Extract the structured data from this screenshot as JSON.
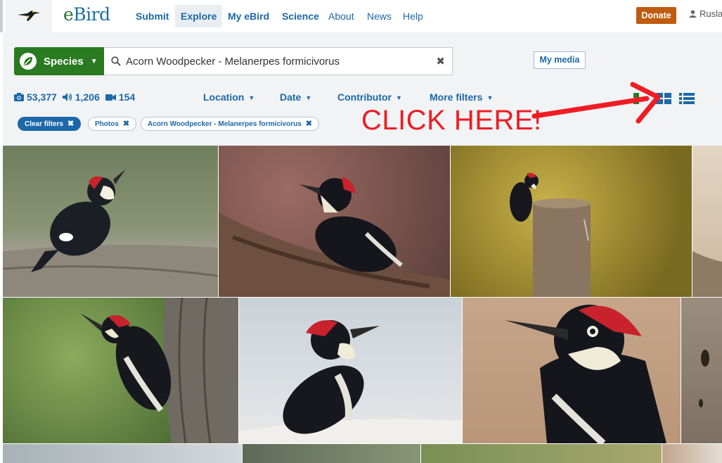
{
  "nav": {
    "brand": "eBird",
    "items": [
      {
        "label": "Submit"
      },
      {
        "label": "Explore"
      },
      {
        "label": "My eBird"
      },
      {
        "label": "Science"
      },
      {
        "label": "About"
      },
      {
        "label": "News"
      },
      {
        "label": "Help"
      }
    ],
    "donate_label": "Donate",
    "user_label": "Rusla"
  },
  "search": {
    "type_label": "Species",
    "value": "Acorn Woodpecker - Melanerpes formicivorus",
    "my_media_label": "My media"
  },
  "counts": {
    "photos": "53,377",
    "audio": "1,206",
    "video": "154"
  },
  "filters": {
    "dropdowns": [
      {
        "label": "Location"
      },
      {
        "label": "Date"
      },
      {
        "label": "Contributor"
      },
      {
        "label": "More filters"
      }
    ],
    "chips": [
      {
        "label": "Clear filters"
      },
      {
        "label": "Photos"
      },
      {
        "label": "Acorn Woodpecker - Melanerpes formicivorus"
      }
    ]
  },
  "annotation": {
    "text": "CLICK HERE!",
    "color": "#ee1d23"
  },
  "colors": {
    "primary": "#1c68a8",
    "species_green": "#297a20",
    "donate_orange": "#be5c10"
  },
  "grid": {
    "photo_count_visible": 13
  }
}
